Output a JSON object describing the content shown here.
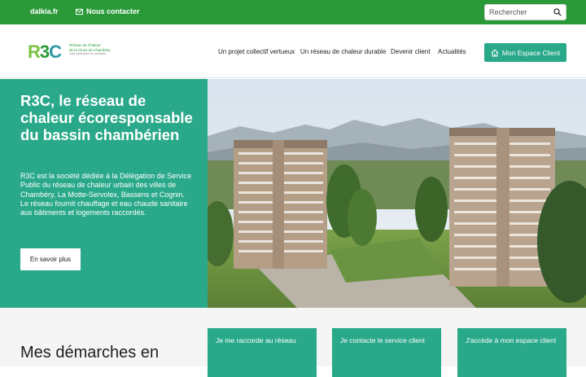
{
  "topbar": {
    "site_link": "dalkia.fr",
    "contact_link": "Nous contacter",
    "search_placeholder": "Rechercher"
  },
  "header": {
    "logo": {
      "mark": [
        "R",
        "3",
        "C"
      ],
      "line1": "Réseau de Chaleur",
      "line2": "de la Cluse de Chambéry",
      "line3": "votre partenaire de confiance"
    },
    "nav": [
      "Un projet collectif vertueux",
      "Un réseau de chaleur durable",
      "Devenir client",
      "Actualités"
    ],
    "client_button": "Mon Espace Client"
  },
  "hero": {
    "title": "R3C, le réseau de chaleur écoresponsable du bassin chambérien",
    "paragraph1": "R3C est la société dédiée à la Délégation de Service Public du réseau de chaleur urbain des villes de Chambéry, La Motte-Servolex, Bassens et Cognin.",
    "paragraph2": "Le réseau fournit chauffage et eau chaude sanitaire aux bâtiments et logements raccordés.",
    "button": "En savoir plus"
  },
  "demarches": {
    "title": "Mes démarches en",
    "cards": [
      "Je me raccorde au réseau",
      "Je contacte le service client",
      "J'accède à mon espace client"
    ]
  },
  "colors": {
    "brand_green": "#2a9a39",
    "accent_teal": "#2aa98a"
  },
  "icons": {
    "contact": "envelope-icon",
    "search": "search-icon",
    "client": "home-icon"
  }
}
